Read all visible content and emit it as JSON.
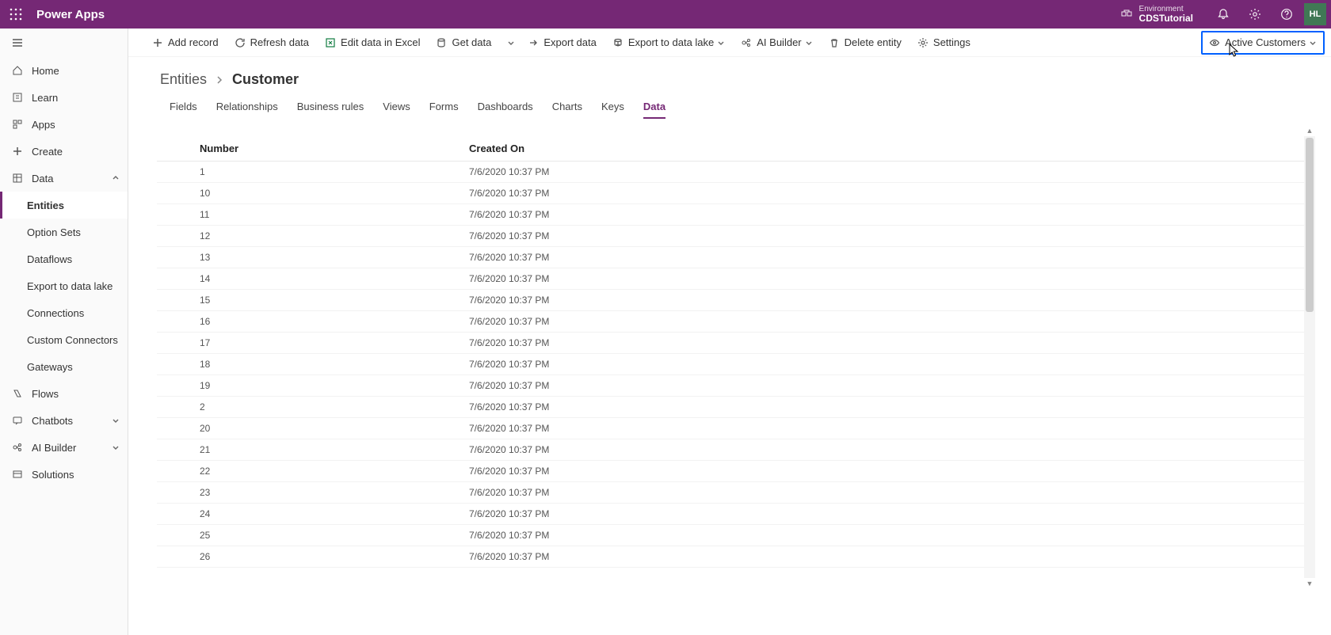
{
  "header": {
    "app_title": "Power Apps",
    "environment_label": "Environment",
    "environment_name": "CDSTutorial",
    "user_initials": "HL"
  },
  "sidebar": {
    "home": "Home",
    "learn": "Learn",
    "apps": "Apps",
    "create": "Create",
    "data": "Data",
    "entities": "Entities",
    "option_sets": "Option Sets",
    "dataflows": "Dataflows",
    "export_lake": "Export to data lake",
    "connections": "Connections",
    "custom_connectors": "Custom Connectors",
    "gateways": "Gateways",
    "flows": "Flows",
    "chatbots": "Chatbots",
    "ai_builder": "AI Builder",
    "solutions": "Solutions"
  },
  "cmdbar": {
    "add_record": "Add record",
    "refresh": "Refresh data",
    "edit_excel": "Edit data in Excel",
    "get_data": "Get data",
    "export_data": "Export data",
    "export_lake": "Export to data lake",
    "ai_builder": "AI Builder",
    "delete_entity": "Delete entity",
    "settings": "Settings",
    "view_selector": "Active Customers"
  },
  "breadcrumb": {
    "root": "Entities",
    "leaf": "Customer"
  },
  "tabs": [
    "Fields",
    "Relationships",
    "Business rules",
    "Views",
    "Forms",
    "Dashboards",
    "Charts",
    "Keys",
    "Data"
  ],
  "active_tab": 8,
  "table": {
    "columns": [
      "Number",
      "Created On"
    ],
    "rows": [
      {
        "number": "1",
        "created": "7/6/2020 10:37 PM"
      },
      {
        "number": "10",
        "created": "7/6/2020 10:37 PM"
      },
      {
        "number": "11",
        "created": "7/6/2020 10:37 PM"
      },
      {
        "number": "12",
        "created": "7/6/2020 10:37 PM"
      },
      {
        "number": "13",
        "created": "7/6/2020 10:37 PM"
      },
      {
        "number": "14",
        "created": "7/6/2020 10:37 PM"
      },
      {
        "number": "15",
        "created": "7/6/2020 10:37 PM"
      },
      {
        "number": "16",
        "created": "7/6/2020 10:37 PM"
      },
      {
        "number": "17",
        "created": "7/6/2020 10:37 PM"
      },
      {
        "number": "18",
        "created": "7/6/2020 10:37 PM"
      },
      {
        "number": "19",
        "created": "7/6/2020 10:37 PM"
      },
      {
        "number": "2",
        "created": "7/6/2020 10:37 PM"
      },
      {
        "number": "20",
        "created": "7/6/2020 10:37 PM"
      },
      {
        "number": "21",
        "created": "7/6/2020 10:37 PM"
      },
      {
        "number": "22",
        "created": "7/6/2020 10:37 PM"
      },
      {
        "number": "23",
        "created": "7/6/2020 10:37 PM"
      },
      {
        "number": "24",
        "created": "7/6/2020 10:37 PM"
      },
      {
        "number": "25",
        "created": "7/6/2020 10:37 PM"
      },
      {
        "number": "26",
        "created": "7/6/2020 10:37 PM"
      }
    ]
  }
}
